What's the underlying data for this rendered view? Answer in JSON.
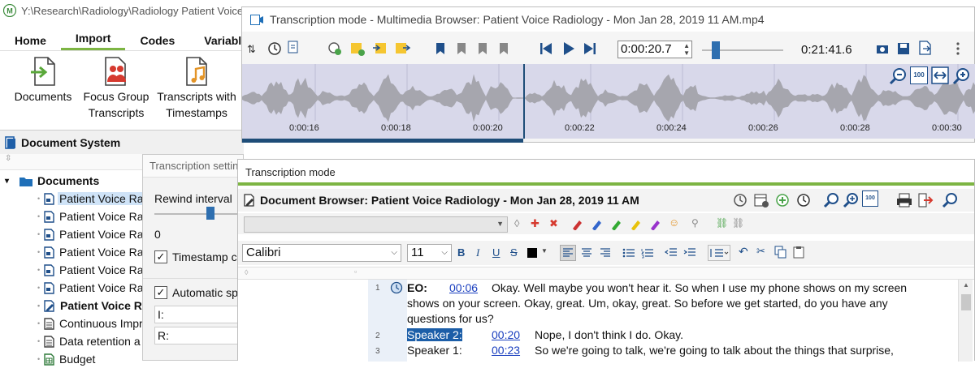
{
  "main_window": {
    "title": "Y:\\Research\\Radiology\\Radiology Patient Voice..."
  },
  "ribbon": {
    "tabs": [
      {
        "label": "Home"
      },
      {
        "label": "Import"
      },
      {
        "label": "Codes"
      },
      {
        "label": "Variabl"
      }
    ],
    "active_tab": "Import",
    "buttons": [
      {
        "label": "Documents",
        "icon": "import-document-icon"
      },
      {
        "label": "Focus Group\nTranscripts",
        "icon": "focus-group-icon"
      },
      {
        "label": "Transcripts with\nTimestamps",
        "icon": "audio-transcript-icon"
      }
    ]
  },
  "document_system": {
    "title": "Document System",
    "root": "Documents",
    "items": [
      {
        "label": "Patient Voice Ra",
        "selected": true
      },
      {
        "label": "Patient Voice Ra"
      },
      {
        "label": "Patient Voice Ra"
      },
      {
        "label": "Patient Voice Ra"
      },
      {
        "label": "Patient Voice Ra"
      },
      {
        "label": "Patient Voice Ra"
      },
      {
        "label": "Patient Voice R",
        "bold": true
      },
      {
        "label": "Continuous Impr"
      },
      {
        "label": "Data retention a"
      },
      {
        "label": "Budget"
      }
    ]
  },
  "transcription_settings": {
    "title": "Transcription setting",
    "rewind_label": "Rewind interval",
    "rewind_value": "0",
    "timestamp_label": "Timestamp c",
    "timestamp_checked": true,
    "auto_label": "Automatic sp",
    "auto_checked": true,
    "speaker_i_label": "I:",
    "speaker_r_label": "R:"
  },
  "multimedia_browser": {
    "title": "Transcription mode - Multimedia Browser:  Patient Voice Radiology  - Mon Jan 28, 2019 11 AM.mp4",
    "current_time": "0:00:20.7",
    "total_time": "0:21:41.6",
    "timeline_labels": [
      "0:00:16",
      "0:00:18",
      "0:00:20",
      "0:00:22",
      "0:00:24",
      "0:00:26",
      "0:00:28",
      "0:00:30"
    ],
    "zoom_label": "100"
  },
  "transcription_mode": {
    "title": "Transcription mode",
    "browser_title": "Document Browser: Patient Voice Radiology  - Mon Jan 28, 2019 11 AM",
    "font": "Calibri",
    "font_size": "11",
    "zoom_label": "100"
  },
  "transcript": [
    {
      "num": "1",
      "speaker": "EO:",
      "time": "00:06",
      "text": "Okay. Well maybe you won't hear it. So when I use my phone shows on my screen",
      "cont": [
        "shows on your screen. Okay, great. Um, okay, great. So before we get started, do you have any",
        "questions for us?"
      ]
    },
    {
      "num": "2",
      "speaker": "Speaker 2:",
      "time": "00:20",
      "text": "Nope, I don't think I do. Okay."
    },
    {
      "num": "3",
      "speaker": "Speaker 1:",
      "time": "00:23",
      "text": "So we're going to talk, we're going to talk about the things that surprise,"
    }
  ]
}
